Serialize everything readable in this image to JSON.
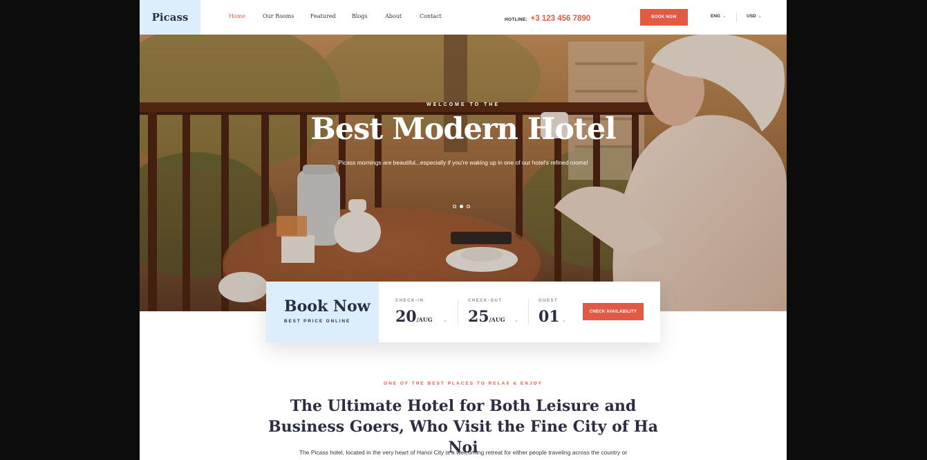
{
  "header": {
    "logo": "Picass",
    "nav": [
      "Home",
      "Our Rooms",
      "Featured",
      "Blogs",
      "About",
      "Contact"
    ],
    "hotline_label": "HOTLINE:",
    "hotline_number": "+3 123 456 7890",
    "book_button": "BOOK NOW",
    "language": "ENG",
    "currency": "USD"
  },
  "hero": {
    "welcome": "WELCOME TO THE",
    "title": "Best Modern Hotel",
    "subtitle": "Picass mornings are beautiful...especially if you're waking up in one of our hotel's refined rooms!",
    "slides_total": 3,
    "active_slide": 2
  },
  "booking": {
    "title": "Book Now",
    "subtitle": "BEST PRICE ONLINE",
    "checkin_label": "CHECK-IN",
    "checkin_day": "20",
    "checkin_month": "/AUG",
    "checkout_label": "CHECK-OUT",
    "checkout_day": "25",
    "checkout_month": "/AUG",
    "guest_label": "GUEST",
    "guest_value": "01",
    "button": "CHECK AVAILABILITY"
  },
  "intro": {
    "eyebrow": "ONE OF THE BEST PLACES TO RELAX & ENJOY",
    "title": "The Ultimate Hotel for Both Leisure and Business Goers, Who Visit the Fine City of Ha Noi",
    "text": "The Picass hotel, located in the very heart of Hanoi City is a welcoming retreat for either people traveling across the country or"
  },
  "colors": {
    "accent": "#e35a44",
    "navy": "#2b2d42",
    "light_blue": "#dceefb"
  }
}
